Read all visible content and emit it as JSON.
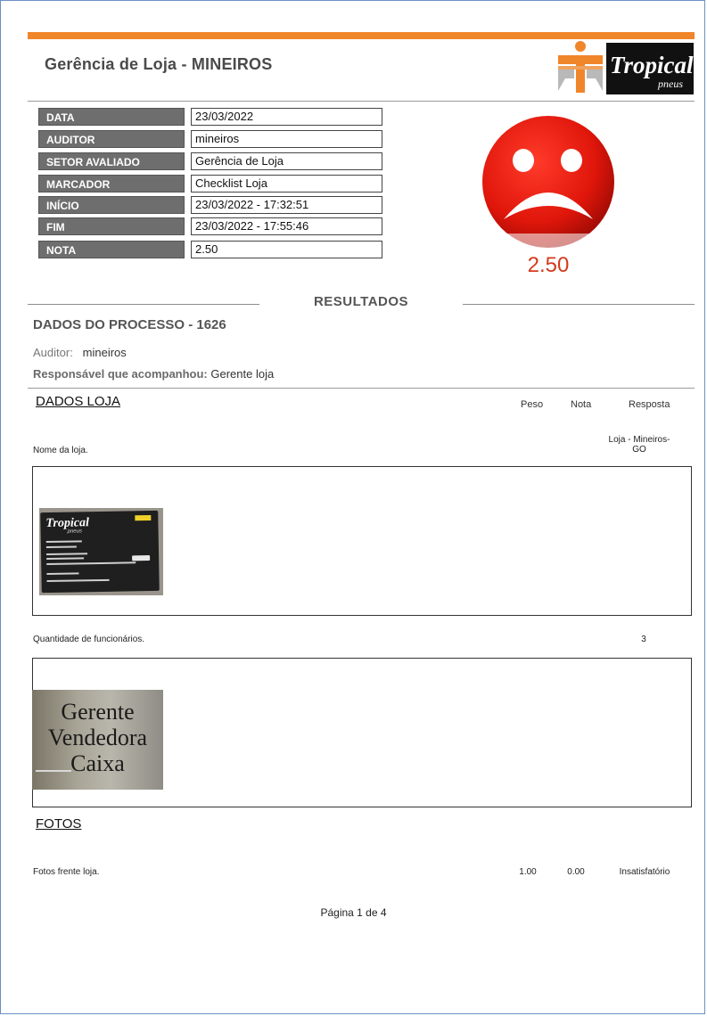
{
  "header": {
    "title": "Gerência de Loja - MINEIROS",
    "logo_text": "Tropical",
    "logo_subtext": "pneus"
  },
  "info": [
    {
      "label": "DATA",
      "value": "23/03/2022"
    },
    {
      "label": "AUDITOR",
      "value": "mineiros"
    },
    {
      "label": "SETOR AVALIADO",
      "value": "Gerência de Loja"
    },
    {
      "label": "MARCADOR",
      "value": "Checklist Loja"
    },
    {
      "label": "INÍCIO",
      "value": "23/03/2022 - 17:32:51"
    },
    {
      "label": "FIM",
      "value": "23/03/2022 - 17:55:46"
    },
    {
      "label": "NOTA",
      "value": "2.50"
    }
  ],
  "score": {
    "value": "2.50",
    "mood": "sad",
    "color": "#d23b1e"
  },
  "results": {
    "title": "RESULTADOS",
    "process_title": "DADOS DO PROCESSO - 1626",
    "auditor_label": "Auditor:",
    "auditor_value": "mineiros",
    "resp_label": "Responsável que acompanhou:",
    "resp_value": "Gerente loja"
  },
  "sections": {
    "dados_loja": {
      "heading": "DADOS LOJA",
      "col_peso": "Peso",
      "col_nota": "Nota",
      "col_resposta": "Resposta",
      "q1": {
        "text": "Nome da loja.",
        "answer_line1": "Loja - Mineiros-",
        "answer_line2": "GO"
      },
      "q2": {
        "text": "Quantidade de funcionários.",
        "answer": "3"
      },
      "card_photo": {
        "brand": "Tropical",
        "sub": "pneus"
      },
      "note_photo": {
        "line1": "Gerente",
        "line2": "Vendedora",
        "line3": "Caixa"
      }
    },
    "fotos": {
      "heading": "FOTOS",
      "q1": {
        "text": "Fotos frente loja.",
        "peso": "1.00",
        "nota": "0.00",
        "resposta": "Insatisfatório"
      }
    }
  },
  "footer": {
    "page": "Página 1 de 4"
  }
}
